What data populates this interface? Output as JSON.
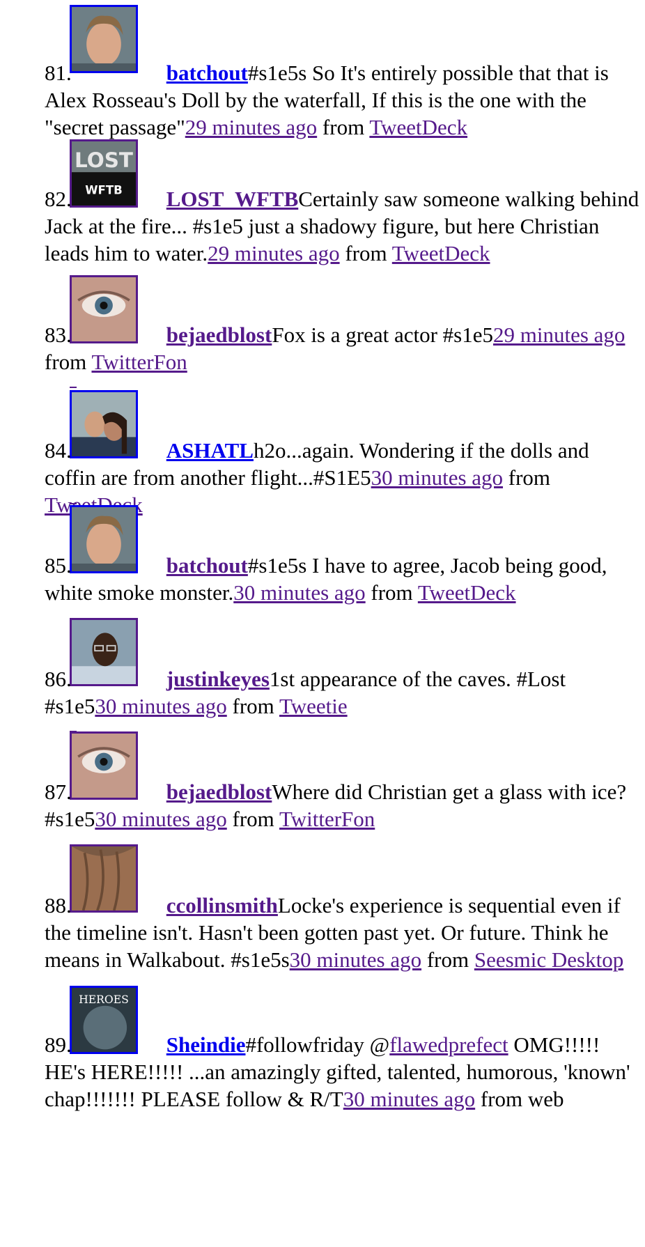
{
  "tweets": [
    {
      "number": "81.",
      "username": "batchout",
      "text": "#s1e5s So It's entirely possible that that is Alex Rosseau's Doll by the waterfall, If this is the one with the \"secret passage\"",
      "time": "29 minutes ago",
      "from_label": " from ",
      "source": "TweetDeck",
      "avatar": "man-face"
    },
    {
      "number": "82.",
      "username": "LOST_WFTB",
      "text": "Certainly saw someone walking behind Jack at the fire... #s1e5 just a shadowy figure, but here Christian leads him to water.",
      "time": "29 minutes ago",
      "from_label": " from ",
      "source": "TweetDeck",
      "avatar": "lost-wftb-logo",
      "avatar_text": "WFTB",
      "avatar_top": "LOST"
    },
    {
      "number": "83.",
      "username": "bejaedblost",
      "text": "Fox is a great actor #s1e5",
      "time": "29 minutes ago",
      "from_label": " from ",
      "source": "TwitterFon",
      "avatar": "eye"
    },
    {
      "number": "84.",
      "username": "ASHATL",
      "text": "h2o...again. Wondering if the dolls and coffin are from another flight...#S1E5",
      "time": "30 minutes ago",
      "from_label": " from ",
      "source": "TweetDeck",
      "avatar": "couple"
    },
    {
      "number": "85.",
      "username": "batchout",
      "text": "#s1e5s I have to agree, Jacob being good, white smoke monster.",
      "time": "30 minutes ago",
      "from_label": " from ",
      "source": "TweetDeck",
      "avatar": "man-face"
    },
    {
      "number": "86.",
      "username": "justinkeyes",
      "text": "1st appearance of the caves. #Lost #s1e5",
      "time": "30 minutes ago",
      "from_label": " from ",
      "source": "Tweetie",
      "avatar": "man-glasses"
    },
    {
      "number": "87.",
      "username": "bejaedblost",
      "text": "Where did Christian get a glass with ice? #s1e5",
      "time": "30 minutes ago",
      "from_label": " from ",
      "source": "TwitterFon",
      "avatar": "eye"
    },
    {
      "number": "88.",
      "username": "ccollinsmith",
      "text": "Locke's experience is sequential even if the timeline isn't. Hasn't been gotten past yet. Or future. Think he means in Walkabout. #s1e5s",
      "time": "30 minutes ago",
      "from_label": " from ",
      "source": "Seesmic Desktop",
      "avatar": "hair"
    },
    {
      "number": "89.",
      "username": "Sheindie",
      "text_before_mention": "#followfriday @",
      "mention": "flawedprefect",
      "text": " OMG!!!!! HE's HERE!!!!! ...an amazingly gifted, talented, humorous, 'known' chap!!!!!!! PLEASE follow & R/T",
      "time": "30 minutes ago",
      "from_label": " from web",
      "avatar": "heroes-logo",
      "avatar_text": "HEROES"
    }
  ],
  "colors": {
    "link": "#0000ee",
    "visited": "#551a8b"
  }
}
